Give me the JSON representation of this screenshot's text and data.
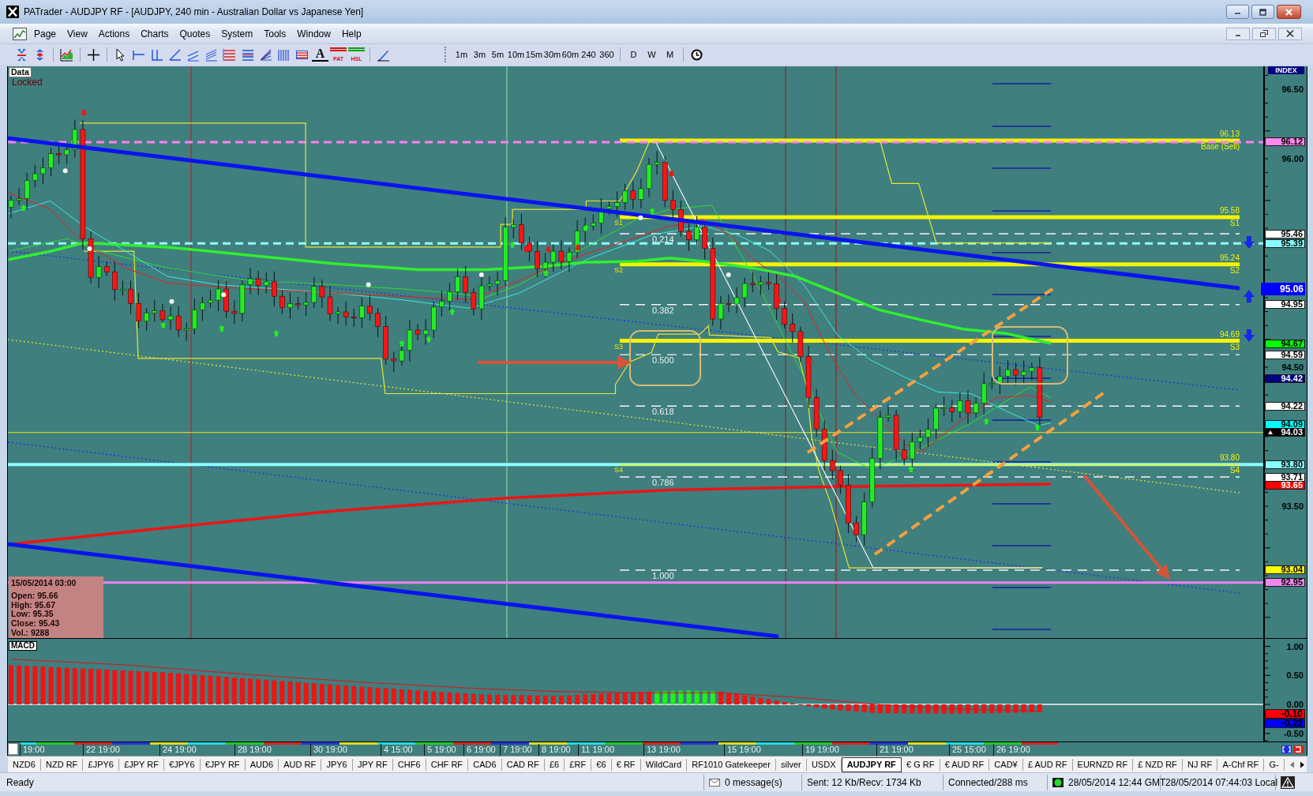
{
  "window": {
    "title": "PATrader - AUDJPY RF - [AUDJPY, 240 min - Australian Dollar vs Japanese Yen]"
  },
  "menu": [
    "Page",
    "View",
    "Actions",
    "Charts",
    "Quotes",
    "System",
    "Tools",
    "Window",
    "Help"
  ],
  "toolbar": {
    "text_tool": "A",
    "pattern_tool": "PAT",
    "hsl_tool": "HSL",
    "timeframes": [
      "1m",
      "3m",
      "5m",
      "10m",
      "15m",
      "30m",
      "60m",
      "240",
      "360"
    ],
    "periods": [
      "D",
      "W",
      "M"
    ]
  },
  "price_chart": {
    "data_label": "Data",
    "lock_label": "Locked",
    "axis_title": "INDEX",
    "axis_ticks": [
      "96.50",
      "96.00",
      "94.50",
      "93.50"
    ],
    "fib_levels": [
      {
        "label": "0.214",
        "price": "95.46",
        "color": "#ffffff"
      },
      {
        "label": "0.382",
        "price": "94.95",
        "color": "#ffffff"
      },
      {
        "label": "0.500",
        "price": "94.59",
        "color": "#ffffff"
      },
      {
        "label": "0.618",
        "price": "94.22",
        "color": "#ffffff"
      },
      {
        "label": "0.786",
        "price": "93.71",
        "color": "#ffffff"
      },
      {
        "label": "1.000",
        "price": "93.04",
        "color": "#ffff00"
      }
    ],
    "pivots": [
      {
        "price": "96.13",
        "name": "Base (Sell)",
        "kind": "thick"
      },
      {
        "price": "95.58",
        "name": "S1",
        "start_label": "S1",
        "kind": "thick"
      },
      {
        "price": "95.24",
        "name": "S2",
        "start_label": "S2",
        "kind": "thick"
      },
      {
        "price": "94.69",
        "name": "S3",
        "start_label": "S3",
        "kind": "thick"
      },
      {
        "price": "93.80",
        "name": "S4",
        "start_label": "S4",
        "kind": "thin"
      }
    ],
    "price_tags": [
      {
        "price": "96.12",
        "color": "#ff88ee",
        "kind": "plain"
      },
      {
        "price": "95.39",
        "color": "#88ffff",
        "kind": "plain"
      },
      {
        "price": "95.06",
        "color": "#0000ff",
        "kind": "large"
      },
      {
        "price": "94.67",
        "color": "#00ff00",
        "kind": "plain"
      },
      {
        "price": "94.42",
        "color": "#000080",
        "kind": "plain"
      },
      {
        "price": "94.09",
        "color": "#00ffff",
        "kind": "plain"
      },
      {
        "price": "94.03",
        "color": "#000000",
        "kind": "last"
      },
      {
        "price": "93.80",
        "color": "#88ffff",
        "kind": "plain"
      },
      {
        "price": "93.65",
        "color": "#ff0000",
        "kind": "plain"
      },
      {
        "price": "92.95",
        "color": "#ee88ee",
        "kind": "plain"
      }
    ],
    "ohlc_box": {
      "date": "15/05/2014 03:00",
      "lines": [
        "Open: 95.66",
        "High: 95.67",
        "Low: 95.35",
        "Close: 95.43",
        "Vol.: 9288"
      ]
    }
  },
  "macd": {
    "label": "MACD",
    "axis_ticks": [
      "1.00",
      "0.50",
      "0.00",
      "-0.50"
    ],
    "tags": [
      {
        "value": "-0.10",
        "color": "#ff0000"
      },
      {
        "value": "-0.22",
        "color": "#0000ff"
      }
    ]
  },
  "time_axis": [
    "19:00",
    "22 19:00",
    "24 19:00",
    "28 19:00",
    "30 19:00",
    "4 15:00",
    "5 19:00",
    "6 19:00",
    "7 19:00",
    "8 19:00",
    "11 19:00",
    "13 19:00",
    "15 19:00",
    "19 19:00",
    "21 19:00",
    "25 15:00",
    "26 19:00"
  ],
  "tabs": [
    {
      "label": "NZD6",
      "selected": false
    },
    {
      "label": "NZD RF",
      "selected": false
    },
    {
      "label": "£JPY6",
      "selected": false
    },
    {
      "label": "£JPY RF",
      "selected": false
    },
    {
      "label": "€JPY6",
      "selected": false
    },
    {
      "label": "€JPY RF",
      "selected": false
    },
    {
      "label": "AUD6",
      "selected": false
    },
    {
      "label": "AUD RF",
      "selected": false
    },
    {
      "label": "JPY6",
      "selected": false
    },
    {
      "label": "JPY RF",
      "selected": false
    },
    {
      "label": "CHF6",
      "selected": false
    },
    {
      "label": "CHF RF",
      "selected": false
    },
    {
      "label": "CAD6",
      "selected": false
    },
    {
      "label": "CAD RF",
      "selected": false
    },
    {
      "label": "£6",
      "selected": false
    },
    {
      "label": "£RF",
      "selected": false
    },
    {
      "label": "€6",
      "selected": false
    },
    {
      "label": "€ RF",
      "selected": false
    },
    {
      "label": "WildCard",
      "selected": false
    },
    {
      "label": "RF1010 Gatekeeper",
      "selected": false
    },
    {
      "label": "silver",
      "selected": false
    },
    {
      "label": "USDX",
      "selected": false
    },
    {
      "label": "AUDJPY RF",
      "selected": true
    },
    {
      "label": "€ G RF",
      "selected": false
    },
    {
      "label": "€ AUD RF",
      "selected": false
    },
    {
      "label": "CAD¥",
      "selected": false
    },
    {
      "label": "£ AUD RF",
      "selected": false
    },
    {
      "label": "EURNZD RF",
      "selected": false
    },
    {
      "label": "£ NZD RF",
      "selected": false
    },
    {
      "label": "NJ RF",
      "selected": false
    },
    {
      "label": "A-Chf RF",
      "selected": false
    },
    {
      "label": "G-",
      "selected": false
    }
  ],
  "status": {
    "text": "Ready",
    "messages": "0 message(s)",
    "traffic": "Sent: 12 Kb/Recv: 1734 Kb",
    "connection": "Connected/288 ms",
    "connected": true,
    "gmt_time": "28/05/2014 12:44 GMT",
    "local_time": "28/05/2014 07:44:03 Local"
  }
}
